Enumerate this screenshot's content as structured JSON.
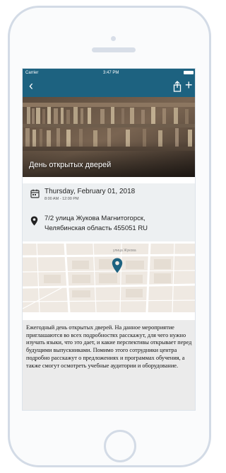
{
  "status_bar": {
    "carrier": "Carrier",
    "time": "3:47 PM"
  },
  "nav": {
    "back_icon": "chevron-left-icon",
    "share_icon": "share-icon",
    "add_icon": "plus-icon",
    "color": "#1d6280"
  },
  "hero": {
    "title": "День открытых дверей"
  },
  "event": {
    "date": "Thursday, February 01, 2018",
    "time": "8:00 AM - 12:00 PM",
    "address_line1": "7/2 улица Жукова Магнитогорск,",
    "address_line2": "Челябинская область 455051 RU"
  },
  "map": {
    "street_label": "улица Жукова",
    "marker_color": "#1d6280"
  },
  "description": "Ежегодный день открытых дверей. На данное мероприятие приглашаются во всех подробностях расскажут, для чего нужно изучать языки, что это дает, и какие перспективы открывает перед будущими выпускниками. Помимо этого сотрудники центра подробно расскажут о предложениях и программах обучения, а также смогут осмотреть учебные аудитории и оборудование."
}
